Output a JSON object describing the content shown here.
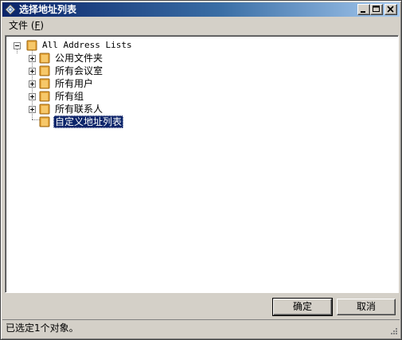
{
  "window": {
    "title": "选择地址列表",
    "colors": {
      "titlebar_start": "#0a246a",
      "titlebar_end": "#a6caf0",
      "face": "#d4d0c8",
      "selection": "#0a246a"
    }
  },
  "menubar": {
    "items": [
      {
        "label_prefix": "文件 (",
        "mnemonic": "F",
        "label_suffix": ")"
      }
    ]
  },
  "tree": {
    "root": {
      "label": "All Address Lists",
      "expanded": true,
      "icon": "folder-icon"
    },
    "children": [
      {
        "label": "公用文件夹",
        "expandable": true,
        "icon": "folder-icon"
      },
      {
        "label": "所有会议室",
        "expandable": true,
        "icon": "folder-icon"
      },
      {
        "label": "所有用户",
        "expandable": true,
        "icon": "folder-icon"
      },
      {
        "label": "所有组",
        "expandable": true,
        "icon": "folder-icon"
      },
      {
        "label": "所有联系人",
        "expandable": true,
        "icon": "folder-icon"
      },
      {
        "label": "自定义地址列表",
        "expandable": false,
        "selected": true,
        "icon": "folder-icon"
      }
    ]
  },
  "buttons": {
    "ok": "确定",
    "cancel": "取消"
  },
  "status": {
    "text": "已选定1个对象。"
  }
}
